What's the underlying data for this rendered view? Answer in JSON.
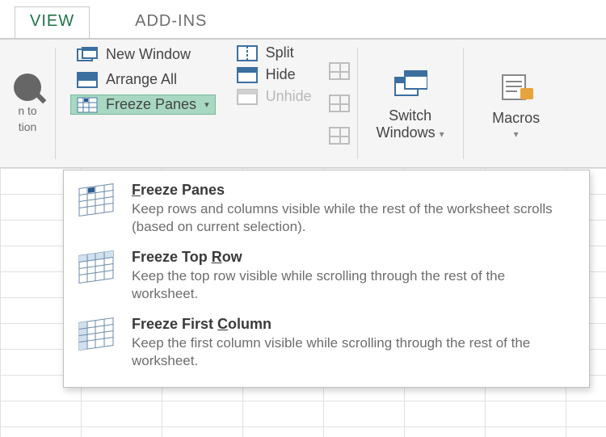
{
  "tabs": {
    "view": "VIEW",
    "addins": "ADD-INS"
  },
  "zoom_group": {
    "line1": "n to",
    "line2": "tion"
  },
  "window_group": {
    "new_window": "New Window",
    "arrange_all": "Arrange All",
    "freeze_panes": "Freeze Panes"
  },
  "split_group": {
    "split": "Split",
    "hide": "Hide",
    "unhide": "Unhide"
  },
  "switch_windows": {
    "line1": "Switch",
    "line2": "Windows"
  },
  "macros": {
    "label": "Macros"
  },
  "dropdown": {
    "items": [
      {
        "title_pre": "",
        "title_ul": "F",
        "title_post": "reeze Panes",
        "desc": "Keep rows and columns visible while the rest of the worksheet scrolls (based on current selection)."
      },
      {
        "title_pre": "Freeze Top ",
        "title_ul": "R",
        "title_post": "ow",
        "desc": "Keep the top row visible while scrolling through the rest of the worksheet."
      },
      {
        "title_pre": "Freeze First ",
        "title_ul": "C",
        "title_post": "olumn",
        "desc": "Keep the first column visible while scrolling through the rest of the worksheet."
      }
    ]
  }
}
